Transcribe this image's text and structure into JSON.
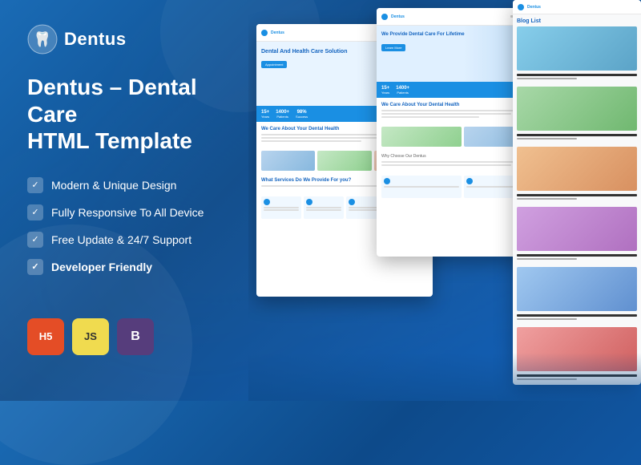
{
  "brand": {
    "name": "Dentus",
    "logo_alt": "Dentus dental logo"
  },
  "title": {
    "line1": "Dentus – Dental Care",
    "line2": "HTML Template"
  },
  "features": [
    {
      "id": "feat-1",
      "text": "Modern & Unique Design"
    },
    {
      "id": "feat-2",
      "text": "Fully Responsive To All Device"
    },
    {
      "id": "feat-3",
      "text": "Free Update & 24/7 Support"
    },
    {
      "id": "feat-4",
      "text": "Developer Friendly"
    }
  ],
  "badges": [
    {
      "id": "html5",
      "label": "HTML5",
      "short": "H5"
    },
    {
      "id": "js",
      "label": "JavaScript",
      "short": "JS"
    },
    {
      "id": "bootstrap",
      "label": "Bootstrap",
      "short": "B"
    }
  ],
  "previews": {
    "main": {
      "hero_title": "Dental And Health Care Solution",
      "stats": [
        "15+",
        "1400+",
        "98%"
      ],
      "section1_title": "We Care About Your Dental Health",
      "section2_title": "What Services Do We Provide For you?"
    },
    "second": {
      "hero_title": "We Provide Dental Care For Lifetime",
      "section_title": "We Care About Your Dental Health"
    },
    "third": {
      "blog_title": "Blog List"
    }
  },
  "colors": {
    "primary": "#1a8fe3",
    "dark_blue": "#1565c0",
    "background_start": "#1a6bb5",
    "background_end": "#0d4a8a"
  }
}
